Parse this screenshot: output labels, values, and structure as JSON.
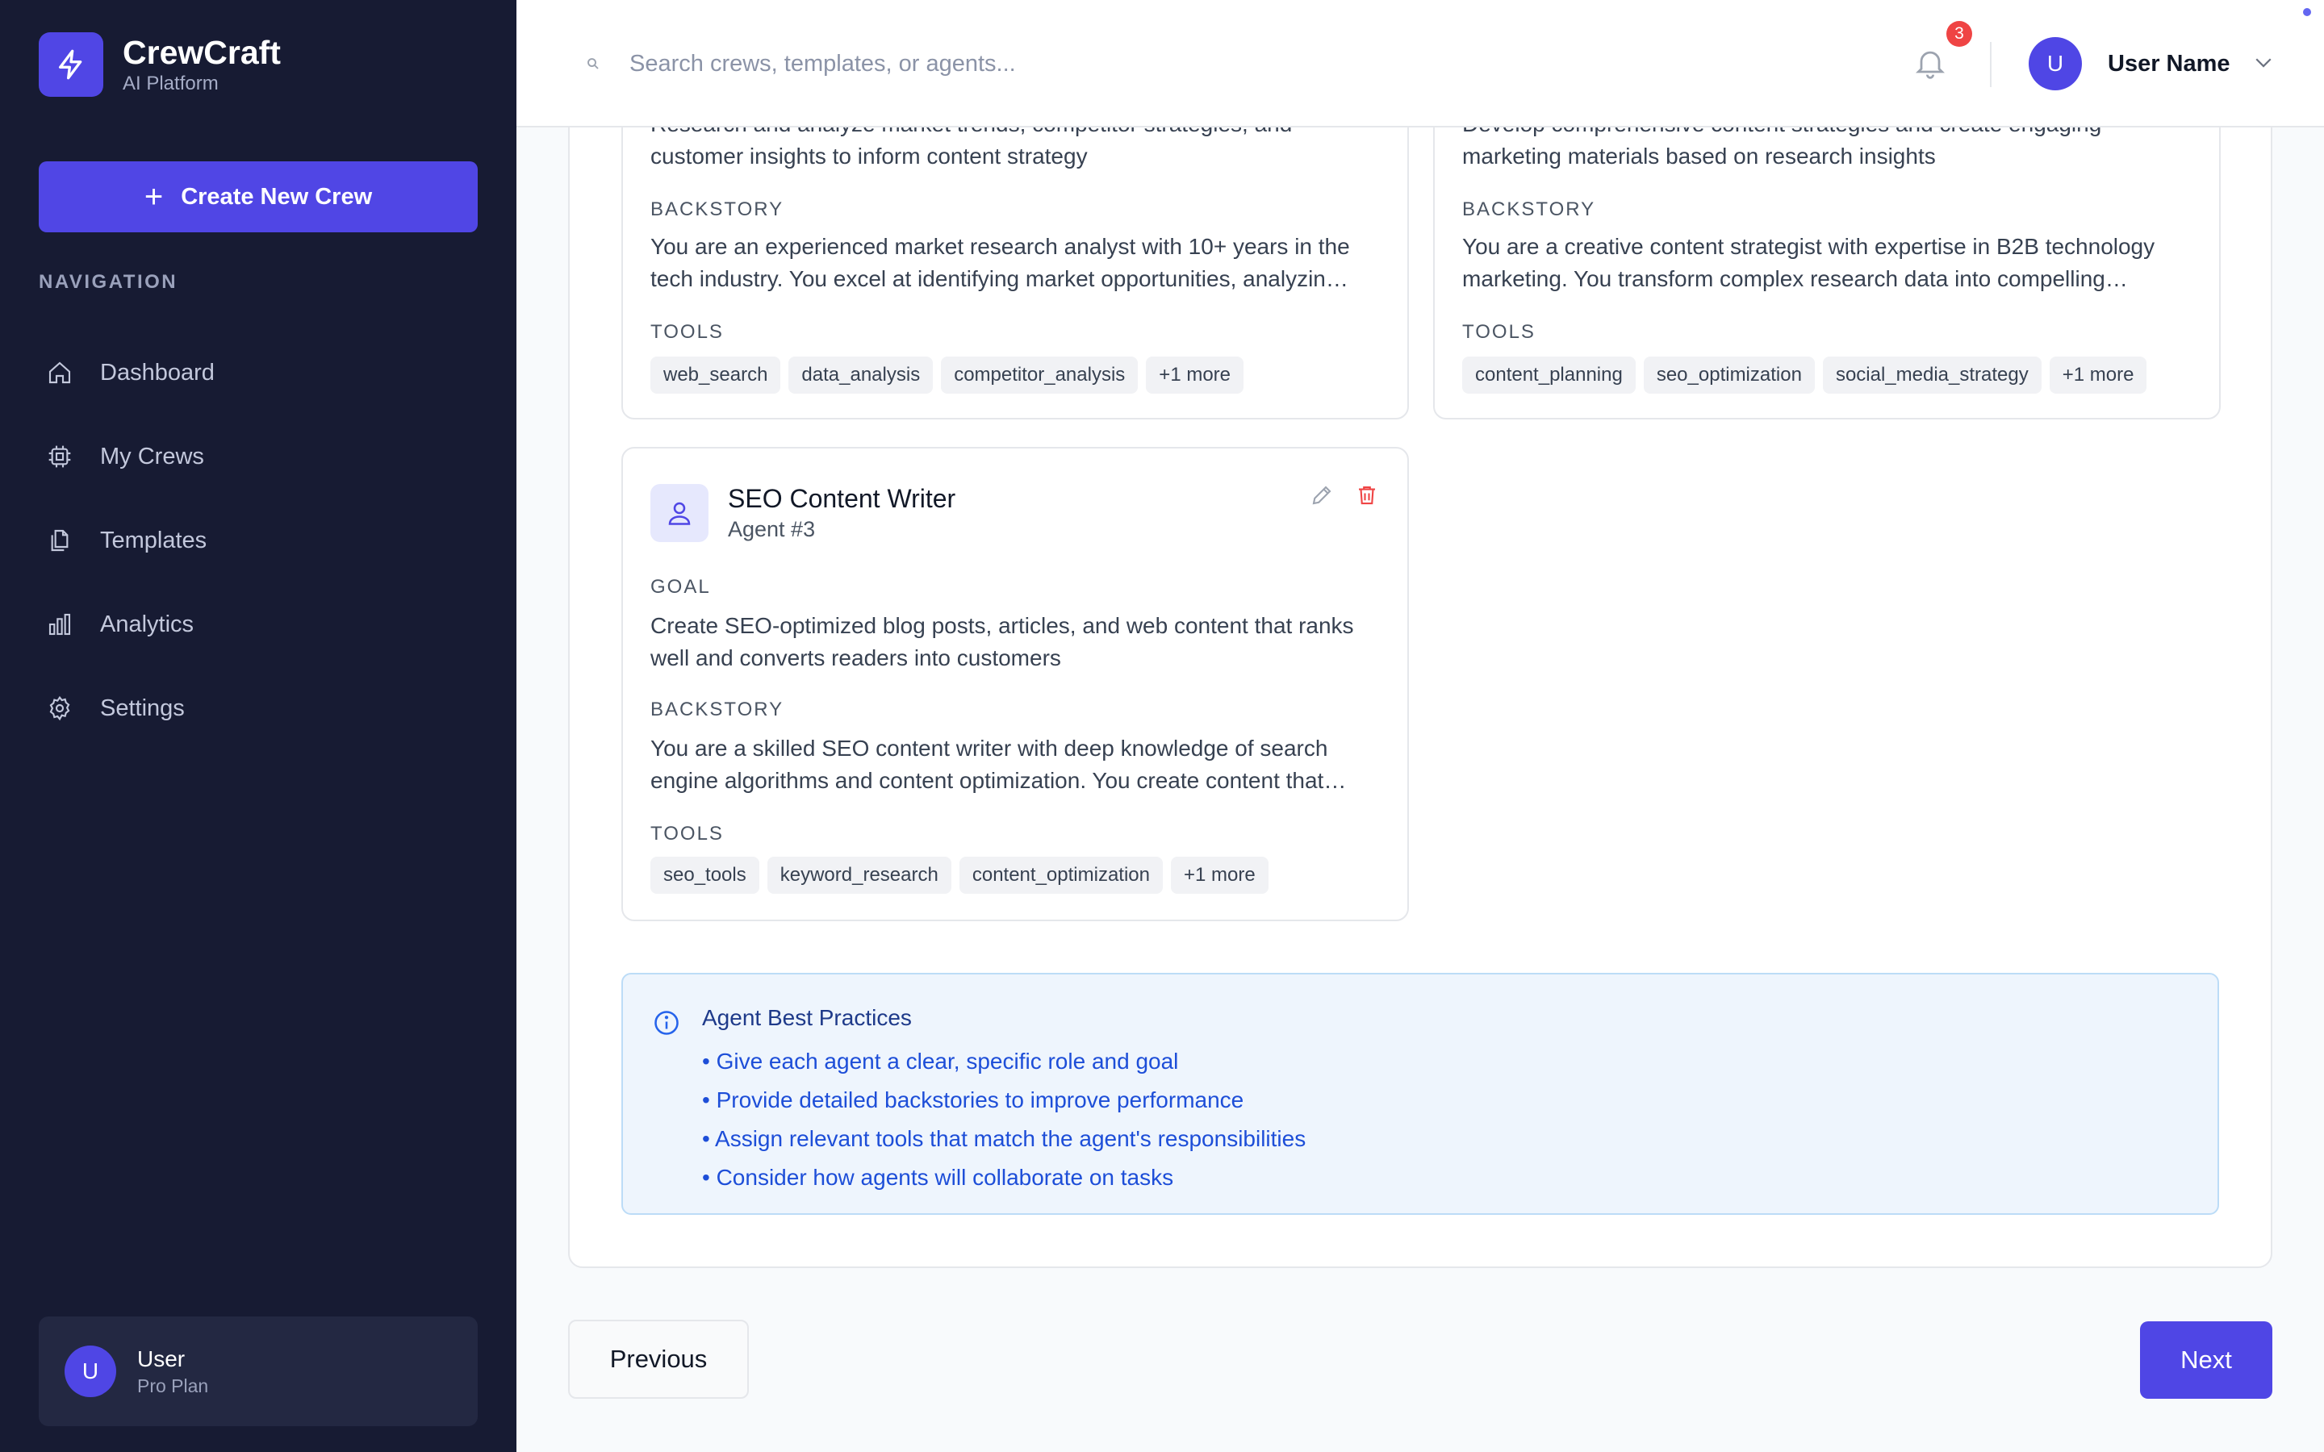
{
  "app": {
    "name": "CrewCraft",
    "subtitle": "AI Platform",
    "create_button": "Create New Crew",
    "nav_heading": "NAVIGATION",
    "nav_items": [
      {
        "label": "Dashboard",
        "icon": "home-icon"
      },
      {
        "label": "My Crews",
        "icon": "chip-icon"
      },
      {
        "label": "Templates",
        "icon": "documents-icon"
      },
      {
        "label": "Analytics",
        "icon": "bar-chart-icon"
      },
      {
        "label": "Settings",
        "icon": "gear-icon"
      }
    ],
    "user": {
      "initial": "U",
      "name": "User",
      "plan": "Pro Plan"
    }
  },
  "header": {
    "search_placeholder": "Search crews, templates, or agents...",
    "notification_count": "3",
    "user_initial": "U",
    "user_name": "User Name"
  },
  "agents": [
    {
      "goal": "Research and analyze market trends, competitor strategies, and customer insights to inform content strategy",
      "backstory_label": "BACKSTORY",
      "backstory": "You are an experienced market research analyst with 10+ years in the tech industry. You excel at identifying market opportunities, analyzin…",
      "tools_label": "TOOLS",
      "tools": [
        "web_search",
        "data_analysis",
        "competitor_analysis",
        "+1 more"
      ]
    },
    {
      "goal": "Develop comprehensive content strategies and create engaging marketing materials based on research insights",
      "backstory_label": "BACKSTORY",
      "backstory": "You are a creative content strategist with expertise in B2B technology marketing. You transform complex research data into compelling…",
      "tools_label": "TOOLS",
      "tools": [
        "content_planning",
        "seo_optimization",
        "social_media_strategy",
        "+1 more"
      ]
    },
    {
      "name": "SEO Content Writer",
      "number": "Agent #3",
      "goal_label": "GOAL",
      "goal": "Create SEO-optimized blog posts, articles, and web content that ranks well and converts readers into customers",
      "backstory_label": "BACKSTORY",
      "backstory": "You are a skilled SEO content writer with deep knowledge of search engine algorithms and content optimization. You create content that…",
      "tools_label": "TOOLS",
      "tools": [
        "seo_tools",
        "keyword_research",
        "content_optimization",
        "+1 more"
      ]
    }
  ],
  "tips": {
    "title": "Agent Best Practices",
    "items": [
      "• Give each agent a clear, specific role and goal",
      "• Provide detailed backstories to improve performance",
      "• Assign relevant tools that match the agent's responsibilities",
      "• Consider how agents will collaborate on tasks"
    ]
  },
  "footer": {
    "previous": "Previous",
    "next": "Next"
  },
  "colors": {
    "primary": "#4f46e5",
    "sidebar": "#171b33",
    "danger": "#ef4444",
    "info_bg": "#eef5fd"
  }
}
